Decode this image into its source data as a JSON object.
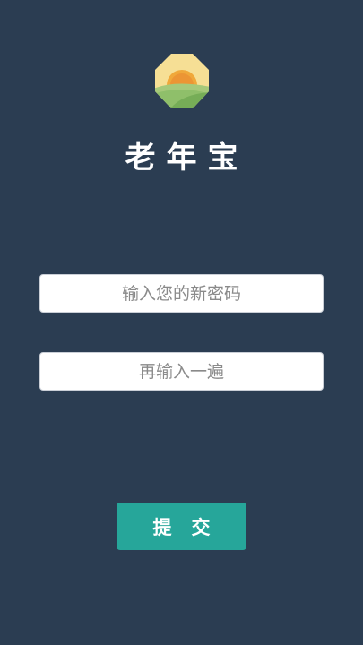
{
  "app": {
    "title": "老年宝"
  },
  "form": {
    "new_password_placeholder": "输入您的新密码",
    "confirm_password_placeholder": "再输入一遍",
    "submit_label": "提交"
  },
  "colors": {
    "background": "#2b3d52",
    "submit_button": "#26a69a",
    "logo_sun": "#f0a83a",
    "logo_field": "#8fbf6a",
    "logo_sky": "#f6df95"
  },
  "icons": {
    "logo": "sunrise-over-field-logo-icon"
  }
}
